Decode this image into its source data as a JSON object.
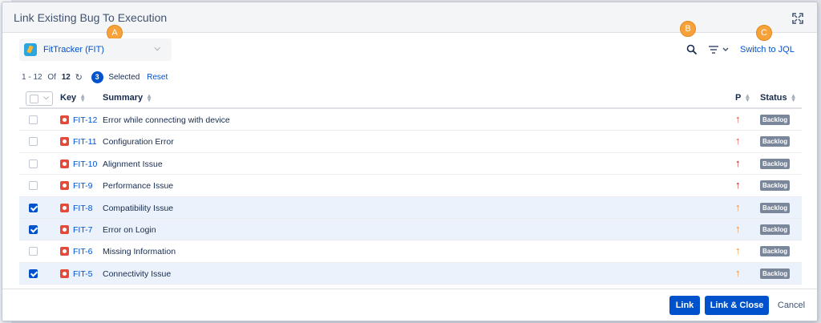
{
  "dialog": {
    "title": "Link Existing Bug To Execution"
  },
  "markers": {
    "a": "A",
    "b": "B",
    "c": "C"
  },
  "project_select": {
    "label": "FitTracker (FIT)"
  },
  "toolbar": {
    "switch_jql": "Switch to JQL"
  },
  "pager": {
    "range": "1 - 12",
    "of_label": "Of",
    "total": "12",
    "selected_count": "3",
    "selected_label": "Selected",
    "reset_label": "Reset"
  },
  "columns": {
    "key": "Key",
    "summary": "Summary",
    "priority": "P",
    "status": "Status"
  },
  "rows": [
    {
      "key": "FIT-12",
      "summary": "Error while connecting with device",
      "checked": false,
      "priority": "high",
      "status": "Backlog"
    },
    {
      "key": "FIT-11",
      "summary": "Configuration Error",
      "checked": false,
      "priority": "high",
      "status": "Backlog"
    },
    {
      "key": "FIT-10",
      "summary": "Alignment Issue",
      "checked": false,
      "priority": "highest",
      "status": "Backlog"
    },
    {
      "key": "FIT-9",
      "summary": "Performance Issue",
      "checked": false,
      "priority": "highest",
      "status": "Backlog"
    },
    {
      "key": "FIT-8",
      "summary": "Compatibility Issue",
      "checked": true,
      "priority": "medium",
      "status": "Backlog"
    },
    {
      "key": "FIT-7",
      "summary": "Error on Login",
      "checked": true,
      "priority": "medium",
      "status": "Backlog"
    },
    {
      "key": "FIT-6",
      "summary": "Missing Information",
      "checked": false,
      "priority": "medium",
      "status": "Backlog"
    },
    {
      "key": "FIT-5",
      "summary": "Connectivity Issue",
      "checked": true,
      "priority": "medium",
      "status": "Backlog"
    }
  ],
  "priority_colors": {
    "highest": "#c1141b",
    "high": "#e5493a",
    "medium": "#f18d2b"
  },
  "footer": {
    "link_label": "Link",
    "link_close_label": "Link & Close",
    "cancel_label": "Cancel"
  }
}
